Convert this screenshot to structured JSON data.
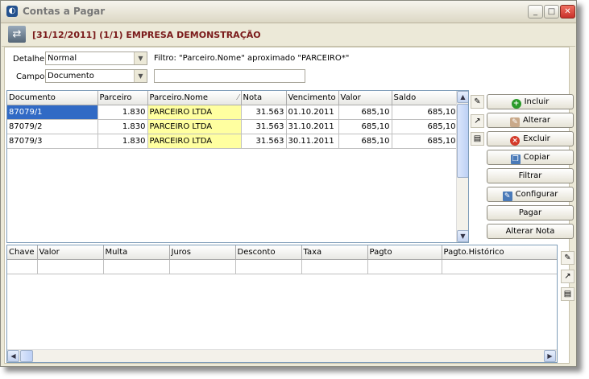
{
  "window": {
    "title": "Contas a Pagar"
  },
  "header": {
    "title": "[31/12/2011] (1/1) EMPRESA DEMONSTRAÇÃO"
  },
  "filters": {
    "detalhe_label": "Detalhe",
    "detalhe_value": "Normal",
    "campo_label": "Campo",
    "campo_value": "Documento",
    "filtro_text": "Filtro: \"Parceiro.Nome\" aproximado \"PARCEIRO*\"",
    "search_value": ""
  },
  "main_grid": {
    "columns": [
      "Documento",
      "Parceiro",
      "Parceiro.Nome",
      "Nota",
      "Vencimento",
      "Valor",
      "Saldo"
    ],
    "rows": [
      [
        "87079/1",
        "1.830",
        "PARCEIRO LTDA",
        "31.563",
        "01.10.2011",
        "685,10",
        "685,10"
      ],
      [
        "87079/2",
        "1.830",
        "PARCEIRO LTDA",
        "31.563",
        "31.10.2011",
        "685,10",
        "685,10"
      ],
      [
        "87079/3",
        "1.830",
        "PARCEIRO LTDA",
        "31.563",
        "30.11.2011",
        "685,10",
        "685,10"
      ]
    ]
  },
  "detail_grid": {
    "columns": [
      "Chave",
      "Valor",
      "Multa",
      "Juros",
      "Desconto",
      "Taxa",
      "Pagto",
      "Pagto.Histórico"
    ]
  },
  "actions": {
    "incluir": "Incluir",
    "alterar": "Alterar",
    "excluir": "Excluir",
    "copiar": "Copiar",
    "filtrar": "Filtrar",
    "configurar": "Configurar",
    "pagar": "Pagar",
    "alterar_nota": "Alterar Nota"
  },
  "colors": {
    "selection": "#316ac5",
    "highlight": "#ffffa0",
    "header_title": "#7a1a1a"
  }
}
